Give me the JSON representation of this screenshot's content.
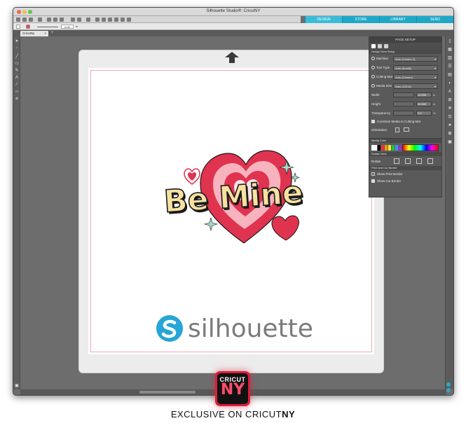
{
  "window": {
    "title": "Silhouette Studio®: CricutNY"
  },
  "nav_tabs": [
    {
      "label": "DESIGN",
      "active": true
    },
    {
      "label": "STORE",
      "active": false
    },
    {
      "label": "LIBRARY",
      "active": false
    },
    {
      "label": "SEND",
      "active": false
    }
  ],
  "toolbar": {
    "zoom_value": "0.00",
    "unit": "in"
  },
  "document_tab": {
    "label": "CricutNy",
    "close": "×"
  },
  "page_setup": {
    "header": "PAGE SETUP",
    "section_title": "Design Area Setup",
    "rows": [
      {
        "label": "Machine",
        "value": "Auto (Cameo 4)"
      },
      {
        "label": "Tool Type",
        "value": "Auto (AutoB)"
      },
      {
        "label": "Cutting Mat",
        "value": "Auto (Cameo)"
      },
      {
        "label": "Media Size",
        "value": "Auto (12x12)"
      }
    ],
    "numeric": [
      {
        "label": "Width",
        "value": "12.000",
        "unit": "in"
      },
      {
        "label": "Height",
        "value": "12.000",
        "unit": "in"
      },
      {
        "label": "Transparency",
        "value": "0.0",
        "unit": "%"
      }
    ],
    "constrain_label": "Constrain Media to Cutting Mat",
    "orientation_label": "Orientation",
    "media_color_title": "Media Color",
    "rotate_view_title": "Rotate View",
    "rotate_label": "Rotate",
    "print_cut_title": "Print and Cut Border",
    "show_print_border": "Show Print Border",
    "show_cut_border": "Show Cut Border"
  },
  "canvas": {
    "design_text": "Be Mine",
    "logo_text": "silhouette"
  },
  "badge": {
    "top": "CRICUT",
    "big": "NY"
  },
  "caption": {
    "prefix": "EXCLUSIVE ON CRICUT",
    "bold": "NY"
  },
  "colors": {
    "accent": "#1ea8c8",
    "heart_red": "#e0334f",
    "heart_pink": "#f7b3be",
    "text_yellow": "#f8e1a0",
    "mint": "#a8dcc8",
    "logo_blue": "#25a6d6"
  }
}
